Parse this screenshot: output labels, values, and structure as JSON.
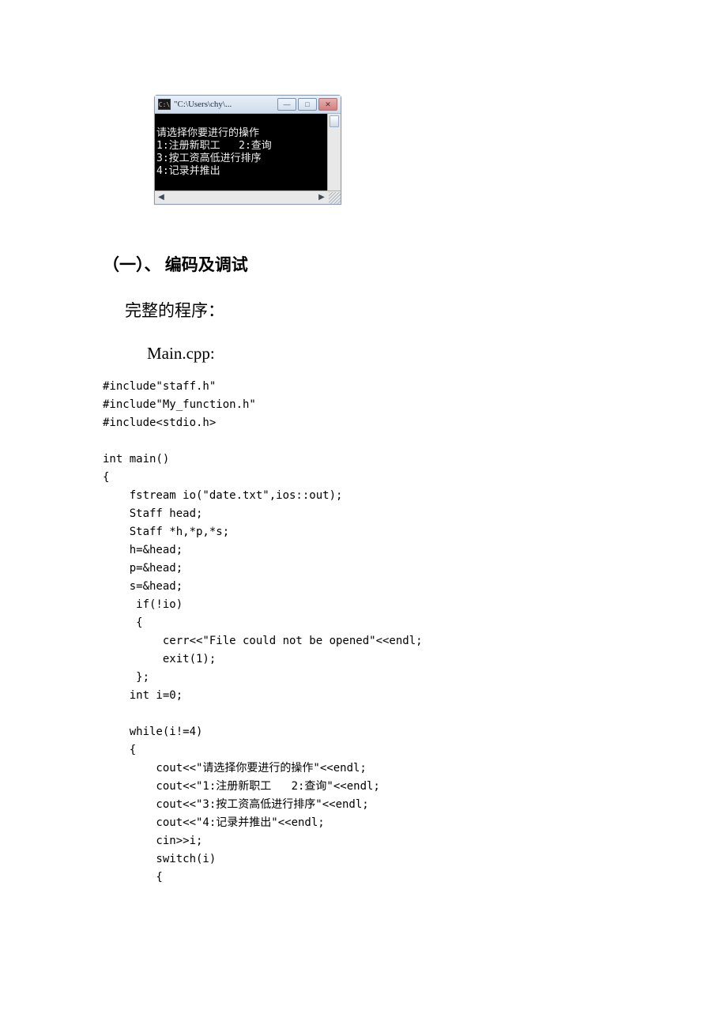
{
  "console": {
    "title": "\"C:\\Users\\chy\\...",
    "icon_text": "C:\\",
    "lines": [
      "请选择你要进行的操作",
      "1:注册新职工   2:查询",
      "3:按工资高低进行排序",
      "4:记录并推出"
    ],
    "min_label": "—",
    "max_label": "□",
    "close_label": "✕",
    "arrow_left": "◀",
    "arrow_right": "▶"
  },
  "section": {
    "heading": "（一）、 编码及调试",
    "subhead": "完整的程序：",
    "filename": "Main.cpp:"
  },
  "code": "#include\"staff.h\"\n#include\"My_function.h\"\n#include<stdio.h>\n\nint main()\n{\n    fstream io(\"date.txt\",ios::out);\n    Staff head;\n    Staff *h,*p,*s;\n    h=&head;\n    p=&head;\n    s=&head;\n     if(!io)\n     {\n         cerr<<\"File could not be opened\"<<endl;\n         exit(1);\n     };\n    int i=0;\n\n    while(i!=4)\n    {\n        cout<<\"请选择你要进行的操作\"<<endl;\n        cout<<\"1:注册新职工   2:查询\"<<endl;\n        cout<<\"3:按工资高低进行排序\"<<endl;\n        cout<<\"4:记录并推出\"<<endl;\n        cin>>i;\n        switch(i)\n        {"
}
